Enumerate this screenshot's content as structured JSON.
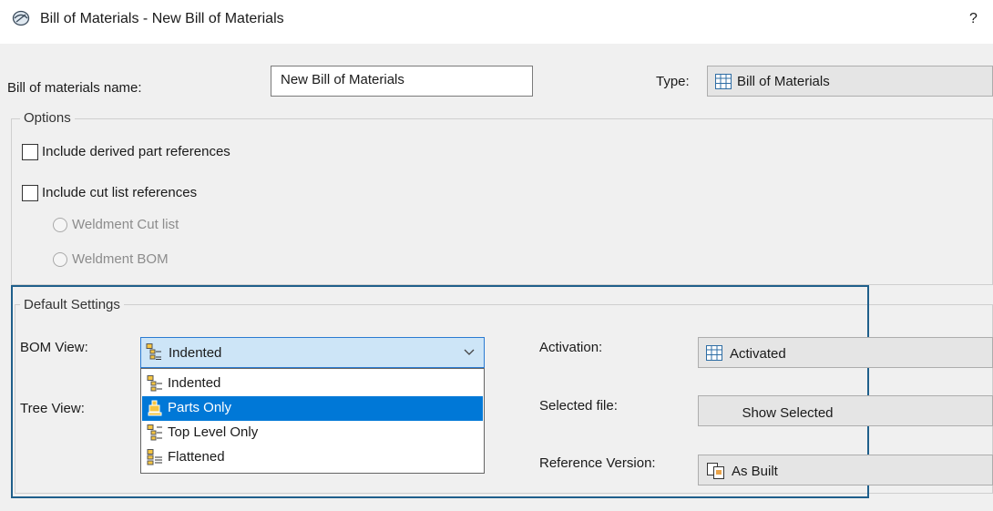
{
  "window": {
    "title": "Bill of Materials - New Bill of Materials",
    "help_label": "?"
  },
  "form": {
    "name_label": "Bill of materials name:",
    "name_value": "New Bill of Materials",
    "type_label": "Type:",
    "type_value": "Bill of Materials"
  },
  "options": {
    "legend": "Options",
    "derived_refs": {
      "label": "Include derived part references",
      "checked": false
    },
    "cut_list_refs": {
      "label": "Include cut list references",
      "checked": false
    },
    "weldment_cut_list": "Weldment Cut list",
    "weldment_bom": "Weldment BOM"
  },
  "default_settings": {
    "legend": "Default Settings",
    "bom_view_label": "BOM View:",
    "bom_view_value": "Indented",
    "tree_view_label": "Tree View:",
    "bom_view_options": [
      {
        "label": "Indented",
        "icon": "indented-icon"
      },
      {
        "label": "Parts Only",
        "icon": "parts-only-icon",
        "selected": true
      },
      {
        "label": "Top Level Only",
        "icon": "top-level-icon"
      },
      {
        "label": "Flattened",
        "icon": "flattened-icon"
      }
    ],
    "activation_label": "Activation:",
    "activation_value": "Activated",
    "selected_file_label": "Selected file:",
    "show_selected_label": "Show Selected",
    "ref_version_label": "Reference Version:",
    "ref_version_value": "As Built"
  },
  "colors": {
    "highlight_border": "#1f5f8b",
    "selection": "#0078d7",
    "combo_focus": "#cde5f7"
  }
}
